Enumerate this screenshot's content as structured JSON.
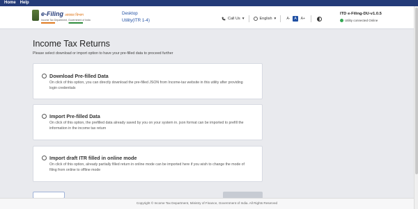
{
  "menubar": {
    "items": [
      "Home",
      "Help"
    ]
  },
  "header": {
    "logo": {
      "title": "e-Filing",
      "hindi": "आयकर विभाग",
      "subtitle": "Income Tax Department, Government of India"
    },
    "product": {
      "line1": "Desktop",
      "line2": "Utility(ITR 1-4)"
    },
    "call_us": "Call Us",
    "language": "English",
    "font_small": "A-",
    "font_normal": "A",
    "font_large": "A+",
    "version": "ITD e-Filing-DU-v1.0.5",
    "status": "Utility connected Online"
  },
  "main": {
    "title": "Income Tax Returns",
    "subtitle": "Please select download or import option to have your pre-filled data to proceed further",
    "options": [
      {
        "title": "Download Pre-filled Data",
        "desc": "On click of this option, you can directly download the pre-filled JSON from Income-tax website in this utility after providing login credentials"
      },
      {
        "title": "Import Pre-filled Data",
        "desc": "On click of this option, the prefilled data already saved by you on your system in. json format can be imported to prefill the information in the income tax return"
      },
      {
        "title": "Import draft ITR filled in online mode",
        "desc": "On click of this option, already partially filled return in online mode can be imported here if you wish to change the mode of filing from online to offline mode"
      }
    ]
  },
  "footer": {
    "text": "Copyright © Income Tax Department, Ministry of Finance, Government of India. All Rights Reserved"
  },
  "colors": {
    "menubar": "#243b78",
    "accent": "#1f4fa3",
    "online": "#34a853"
  }
}
